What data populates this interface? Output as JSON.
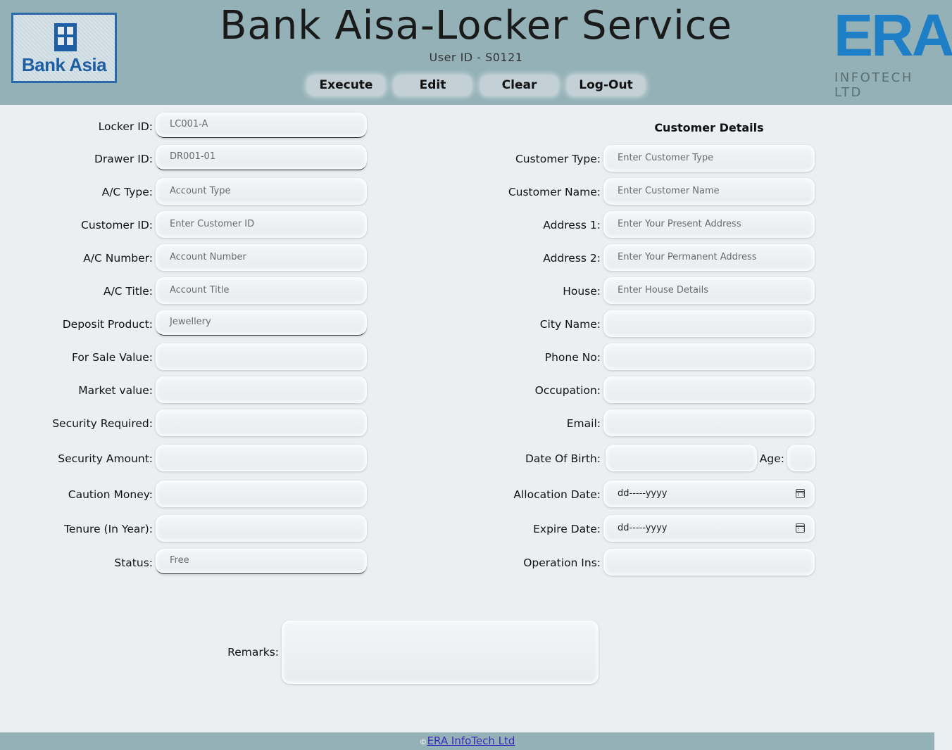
{
  "header": {
    "left_logo_text": "Bank Asia",
    "title": "Bank Aisa-Locker Service",
    "user_id": "User ID - S0121",
    "buttons": {
      "execute": "Execute",
      "edit": "Edit",
      "clear": "Clear",
      "logout": "Log-Out"
    },
    "right_logo": {
      "era": "ERA",
      "sub": "INFOTECH LTD"
    }
  },
  "left_form": {
    "locker_id": {
      "label": "Locker ID:",
      "value": "LC001-A"
    },
    "drawer_id": {
      "label": "Drawer ID:",
      "value": "DR001-01"
    },
    "ac_type": {
      "label": "A/C Type:",
      "placeholder": "Account Type"
    },
    "customer_id": {
      "label": "Customer ID:",
      "placeholder": "Enter Customer ID"
    },
    "ac_number": {
      "label": "A/C Number:",
      "placeholder": "Account Number"
    },
    "ac_title": {
      "label": "A/C Title:",
      "placeholder": "Account Title"
    },
    "deposit_product": {
      "label": "Deposit Product:",
      "value": "Jewellery"
    },
    "for_sale_value": {
      "label": "For Sale Value:",
      "value": ""
    },
    "market_value": {
      "label": "Market value:",
      "value": ""
    },
    "security_required": {
      "label": "Security Required:",
      "value": ""
    },
    "security_amount": {
      "label": "Security Amount:",
      "value": ""
    },
    "caution_money": {
      "label": "Caution Money:",
      "value": ""
    },
    "tenure": {
      "label": "Tenure (In Year):",
      "value": ""
    },
    "status": {
      "label": "Status:",
      "value": "Free"
    }
  },
  "customer_details": {
    "heading": "Customer Details",
    "customer_type": {
      "label": "Customer Type:",
      "placeholder": "Enter Customer Type"
    },
    "customer_name": {
      "label": "Customer Name:",
      "placeholder": "Enter Customer Name"
    },
    "address1": {
      "label": "Address 1:",
      "placeholder": "Enter Your Present Address"
    },
    "address2": {
      "label": "Address 2:",
      "placeholder": "Enter Your Permanent Address"
    },
    "house": {
      "label": "House:",
      "placeholder": "Enter House Details"
    },
    "city_name": {
      "label": "City Name:",
      "value": ""
    },
    "phone_no": {
      "label": "Phone No:",
      "value": ""
    },
    "occupation": {
      "label": "Occupation:",
      "value": ""
    },
    "email": {
      "label": "Email:",
      "value": ""
    },
    "date_of_birth": {
      "label": "Date Of Birth:",
      "value": ""
    },
    "age": {
      "label": "Age:",
      "value": ""
    },
    "allocation_date": {
      "label": "Allocation Date:",
      "value": "dd-----yyyy"
    },
    "expire_date": {
      "label": "Expire Date:",
      "value": "dd-----yyyy"
    },
    "operation_ins": {
      "label": "Operation Ins:",
      "value": ""
    }
  },
  "remarks": {
    "label": "Remarks:",
    "value": ""
  },
  "footer": {
    "copyright_symbol": "©",
    "link_text": "ERA InfoTech Ltd"
  }
}
